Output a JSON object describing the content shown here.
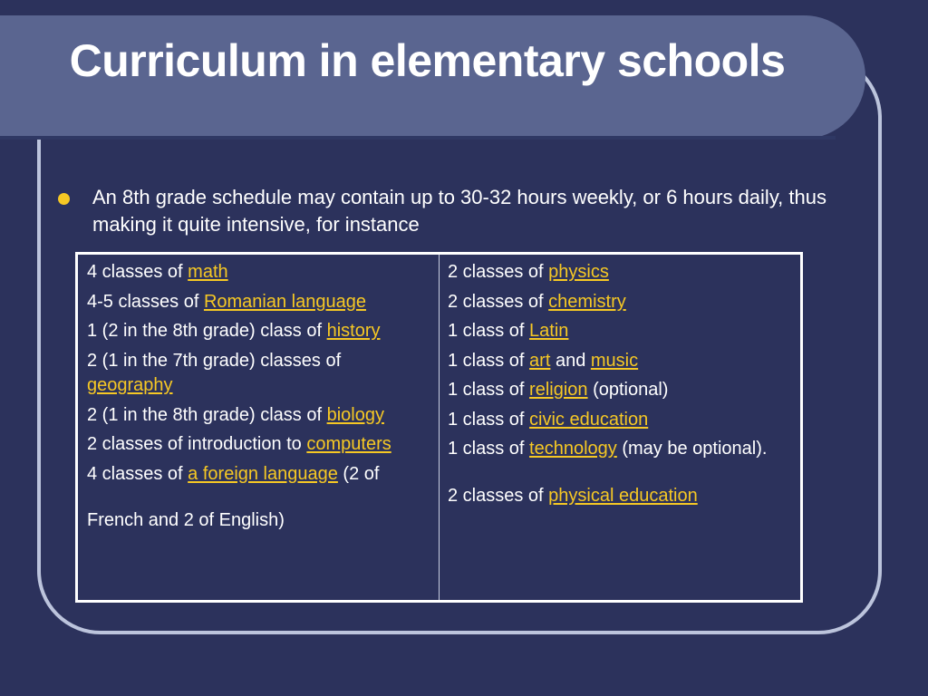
{
  "slide": {
    "title": "Curriculum in elementary schools",
    "bullet": "An 8th grade schedule may contain up to 30-32 hours weekly, or 6 hours daily, thus making it quite intensive, for instance",
    "colors": {
      "background": "#2c325c",
      "title_band": "#5a6590",
      "frame": "#bcc4dc",
      "accent_link": "#f6c824",
      "text": "#ffffff"
    }
  },
  "table": {
    "left": [
      {
        "pre": "4 classes of ",
        "link": "math",
        "post": ""
      },
      {
        "pre": "4-5 classes of ",
        "link": "Romanian language",
        "post": ""
      },
      {
        "pre": "1 (2 in the 8th grade) class of ",
        "link": "history",
        "post": ""
      },
      {
        "pre": "2 (1 in the 7th grade) classes of ",
        "link": "geography",
        "post": ""
      },
      {
        "pre": "2 (1 in the 8th grade) class of ",
        "link": "biology",
        "post": ""
      },
      {
        "pre": "2 classes of introduction to ",
        "link": "computers",
        "post": ""
      },
      {
        "pre": "4 classes of ",
        "link": "a foreign language",
        "post": " (2 of"
      },
      {
        "pre": "French and 2 of English)",
        "link": "",
        "post": ""
      }
    ],
    "right": [
      {
        "pre": "2 classes of ",
        "link": "physics",
        "post": ""
      },
      {
        "pre": "2 classes of ",
        "link": "chemistry",
        "post": ""
      },
      {
        "pre": "1 class of ",
        "link": "Latin",
        "post": ""
      },
      {
        "pre": "1 class of ",
        "link": "art",
        "mid": " and ",
        "link2": "music",
        "post": ""
      },
      {
        "pre": "1 class of ",
        "link": "religion",
        "post": " (optional)"
      },
      {
        "pre": "1 class of ",
        "link": "civic education",
        "post": ""
      },
      {
        "pre": "1 class of ",
        "link": "technology",
        "post": " (may be optional)."
      },
      {
        "pre": "2 classes of ",
        "link": "physical education",
        "post": ""
      }
    ]
  }
}
